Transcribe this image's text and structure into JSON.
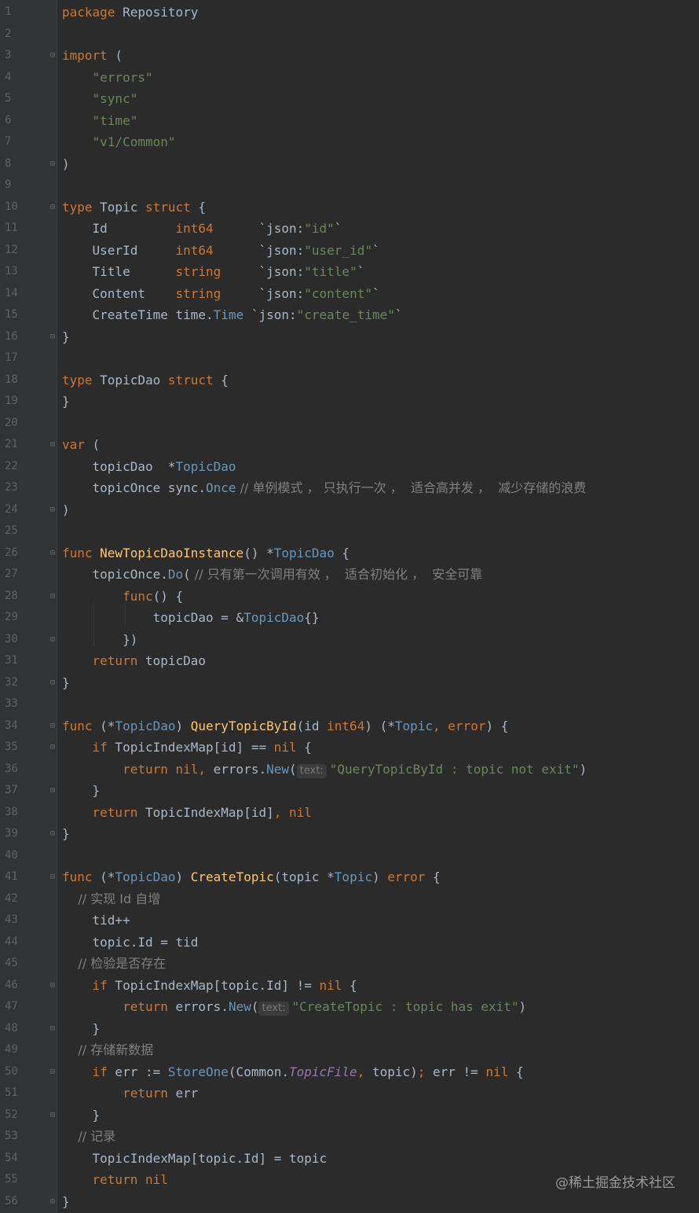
{
  "watermark": "@稀土掘金技术社区",
  "colors": {
    "background": "#2b2b2b",
    "keyword": "#cc7832",
    "string": "#6a8759",
    "function": "#ffc66d",
    "comment": "#808080",
    "type": "#6897bb"
  },
  "lines": [
    {
      "n": "1",
      "tokens": [
        [
          "kw",
          "package"
        ],
        [
          "id",
          " Repository"
        ]
      ]
    },
    {
      "n": "2",
      "tokens": []
    },
    {
      "n": "3",
      "fold": true,
      "tokens": [
        [
          "kw",
          "import"
        ],
        [
          "id",
          " ("
        ]
      ]
    },
    {
      "n": "4",
      "tokens": [
        [
          "str",
          "    \"errors\""
        ]
      ]
    },
    {
      "n": "5",
      "tokens": [
        [
          "str",
          "    \"sync\""
        ]
      ]
    },
    {
      "n": "6",
      "tokens": [
        [
          "str",
          "    \"time\""
        ]
      ]
    },
    {
      "n": "7",
      "tokens": [
        [
          "str",
          "    \"v1/Common\""
        ]
      ]
    },
    {
      "n": "8",
      "fold": true,
      "tokens": [
        [
          "id",
          ")"
        ]
      ]
    },
    {
      "n": "9",
      "tokens": []
    },
    {
      "n": "10",
      "fold": true,
      "tokens": [
        [
          "kw",
          "type"
        ],
        [
          "id",
          " Topic "
        ],
        [
          "kw",
          "struct"
        ],
        [
          "id",
          " {"
        ]
      ]
    },
    {
      "n": "11",
      "tokens": [
        [
          "id",
          "    Id         "
        ],
        [
          "kw",
          "int64"
        ],
        [
          "id",
          "      `json:"
        ],
        [
          "str",
          "\"id\""
        ],
        [
          "id",
          "`"
        ]
      ]
    },
    {
      "n": "12",
      "tokens": [
        [
          "id",
          "    UserId     "
        ],
        [
          "kw",
          "int64"
        ],
        [
          "id",
          "      `json:"
        ],
        [
          "str",
          "\"user_id\""
        ],
        [
          "id",
          "`"
        ]
      ]
    },
    {
      "n": "13",
      "tokens": [
        [
          "id",
          "    Title      "
        ],
        [
          "kw",
          "string"
        ],
        [
          "id",
          "     `json:"
        ],
        [
          "str",
          "\"title\""
        ],
        [
          "id",
          "`"
        ]
      ]
    },
    {
      "n": "14",
      "tokens": [
        [
          "id",
          "    Content    "
        ],
        [
          "kw",
          "string"
        ],
        [
          "id",
          "     `json:"
        ],
        [
          "str",
          "\"content\""
        ],
        [
          "id",
          "`"
        ]
      ]
    },
    {
      "n": "15",
      "tokens": [
        [
          "id",
          "    CreateTime "
        ],
        [
          "id",
          "time."
        ],
        [
          "type",
          "Time"
        ],
        [
          "id",
          " `json:"
        ],
        [
          "str",
          "\"create_time\""
        ],
        [
          "id",
          "`"
        ]
      ]
    },
    {
      "n": "16",
      "fold": true,
      "tokens": [
        [
          "id",
          "}"
        ]
      ]
    },
    {
      "n": "17",
      "tokens": []
    },
    {
      "n": "18",
      "tokens": [
        [
          "kw",
          "type"
        ],
        [
          "id",
          " TopicDao "
        ],
        [
          "kw",
          "struct"
        ],
        [
          "id",
          " {"
        ]
      ]
    },
    {
      "n": "19",
      "tokens": [
        [
          "id",
          "}"
        ]
      ]
    },
    {
      "n": "20",
      "tokens": []
    },
    {
      "n": "21",
      "fold": true,
      "tokens": [
        [
          "kw",
          "var"
        ],
        [
          "id",
          " ("
        ]
      ]
    },
    {
      "n": "22",
      "tokens": [
        [
          "id",
          "    topicDao  *"
        ],
        [
          "type",
          "TopicDao"
        ]
      ]
    },
    {
      "n": "23",
      "tokens": [
        [
          "id",
          "    topicOnce "
        ],
        [
          "id",
          "sync."
        ],
        [
          "type",
          "Once"
        ],
        [
          "cmt",
          " // 单例模式 ， 只执行一次 ，  适合高并发 ，  减少存储的浪费"
        ]
      ]
    },
    {
      "n": "24",
      "fold": true,
      "tokens": [
        [
          "id",
          ")"
        ]
      ]
    },
    {
      "n": "25",
      "tokens": []
    },
    {
      "n": "26",
      "fold": true,
      "tokens": [
        [
          "kw",
          "func"
        ],
        [
          "fn",
          " NewTopicDaoInstance"
        ],
        [
          "id",
          "() *"
        ],
        [
          "type",
          "TopicDao"
        ],
        [
          "id",
          " {"
        ]
      ]
    },
    {
      "n": "27",
      "tokens": [
        [
          "id",
          "    topicOnce."
        ],
        [
          "type",
          "Do"
        ],
        [
          "id",
          "("
        ],
        [
          "cmt",
          " // 只有第一次调用有效 ，  适合初始化 ，  安全可靠"
        ]
      ]
    },
    {
      "n": "28",
      "fold": true,
      "tokens": [
        [
          "kw",
          "        func"
        ],
        [
          "id",
          "() {"
        ]
      ]
    },
    {
      "n": "29",
      "tokens": [
        [
          "id",
          "            topicDao = &"
        ],
        [
          "type",
          "TopicDao"
        ],
        [
          "id",
          "{}"
        ]
      ]
    },
    {
      "n": "30",
      "fold": true,
      "tokens": [
        [
          "id",
          "        })"
        ]
      ]
    },
    {
      "n": "31",
      "tokens": [
        [
          "kw",
          "    return"
        ],
        [
          "id",
          " topicDao"
        ]
      ]
    },
    {
      "n": "32",
      "fold": true,
      "tokens": [
        [
          "id",
          "}"
        ]
      ]
    },
    {
      "n": "33",
      "tokens": []
    },
    {
      "n": "34",
      "fold": true,
      "tokens": [
        [
          "kw",
          "func"
        ],
        [
          "id",
          " (*"
        ],
        [
          "type",
          "TopicDao"
        ],
        [
          "id",
          ") "
        ],
        [
          "fn",
          "QueryTopicById"
        ],
        [
          "id",
          "(id "
        ],
        [
          "kw",
          "int64"
        ],
        [
          "id",
          ") (*"
        ],
        [
          "type",
          "Topic"
        ],
        [
          "kw",
          ", error"
        ],
        [
          "id",
          ") {"
        ]
      ]
    },
    {
      "n": "35",
      "fold": true,
      "tokens": [
        [
          "kw",
          "    if"
        ],
        [
          "id",
          " TopicIndexMap[id] == "
        ],
        [
          "kw",
          "nil"
        ],
        [
          "id",
          " {"
        ]
      ]
    },
    {
      "n": "36",
      "tokens": [
        [
          "kw",
          "        return nil, "
        ],
        [
          "id",
          "errors."
        ],
        [
          "type",
          "New"
        ],
        [
          "id",
          "("
        ],
        [
          "hint",
          "text:"
        ],
        [
          "str",
          "\"QueryTopicById : topic not exit\""
        ],
        [
          "id",
          ")"
        ]
      ]
    },
    {
      "n": "37",
      "fold": true,
      "tokens": [
        [
          "id",
          "    }"
        ]
      ]
    },
    {
      "n": "38",
      "tokens": [
        [
          "kw",
          "    return"
        ],
        [
          "id",
          " TopicIndexMap[id]"
        ],
        [
          "kw",
          ", nil"
        ]
      ]
    },
    {
      "n": "39",
      "fold": true,
      "tokens": [
        [
          "id",
          "}"
        ]
      ]
    },
    {
      "n": "40",
      "tokens": []
    },
    {
      "n": "41",
      "fold": true,
      "tokens": [
        [
          "kw",
          "func"
        ],
        [
          "id",
          " (*"
        ],
        [
          "type",
          "TopicDao"
        ],
        [
          "id",
          ") "
        ],
        [
          "fn",
          "CreateTopic"
        ],
        [
          "id",
          "(topic *"
        ],
        [
          "type",
          "Topic"
        ],
        [
          "id",
          ") "
        ],
        [
          "kw",
          "error"
        ],
        [
          "id",
          " {"
        ]
      ]
    },
    {
      "n": "42",
      "tokens": [
        [
          "cmt",
          "    // 实现 Id 自增"
        ]
      ]
    },
    {
      "n": "43",
      "tokens": [
        [
          "id",
          "    tid++"
        ]
      ]
    },
    {
      "n": "44",
      "tokens": [
        [
          "id",
          "    topic.Id = tid"
        ]
      ]
    },
    {
      "n": "45",
      "tokens": [
        [
          "cmt",
          "    // 检验是否存在"
        ]
      ]
    },
    {
      "n": "46",
      "fold": true,
      "tokens": [
        [
          "kw",
          "    if"
        ],
        [
          "id",
          " TopicIndexMap[topic.Id] != "
        ],
        [
          "kw",
          "nil"
        ],
        [
          "id",
          " {"
        ]
      ]
    },
    {
      "n": "47",
      "tokens": [
        [
          "kw",
          "        return "
        ],
        [
          "id",
          "errors."
        ],
        [
          "type",
          "New"
        ],
        [
          "id",
          "("
        ],
        [
          "hint",
          "text:"
        ],
        [
          "str",
          "\"CreateTopic : topic has exit\""
        ],
        [
          "id",
          ")"
        ]
      ]
    },
    {
      "n": "48",
      "fold": true,
      "tokens": [
        [
          "id",
          "    }"
        ]
      ]
    },
    {
      "n": "49",
      "tokens": [
        [
          "cmt",
          "    // 存储新数据"
        ]
      ]
    },
    {
      "n": "50",
      "fold": true,
      "tokens": [
        [
          "kw",
          "    if"
        ],
        [
          "id",
          " err := "
        ],
        [
          "type",
          "StoreOne"
        ],
        [
          "id",
          "(Common."
        ],
        [
          "fld",
          "TopicFile"
        ],
        [
          "kw",
          ", "
        ],
        [
          "id",
          "topic)"
        ],
        [
          "kw",
          "; "
        ],
        [
          "id",
          "err != "
        ],
        [
          "kw",
          "nil"
        ],
        [
          "id",
          " {"
        ]
      ]
    },
    {
      "n": "51",
      "tokens": [
        [
          "kw",
          "        return"
        ],
        [
          "id",
          " err"
        ]
      ]
    },
    {
      "n": "52",
      "fold": true,
      "tokens": [
        [
          "id",
          "    }"
        ]
      ]
    },
    {
      "n": "53",
      "tokens": [
        [
          "cmt",
          "    // 记录"
        ]
      ]
    },
    {
      "n": "54",
      "tokens": [
        [
          "id",
          "    TopicIndexMap[topic.Id] = topic"
        ]
      ]
    },
    {
      "n": "55",
      "tokens": [
        [
          "kw",
          "    return nil"
        ]
      ]
    },
    {
      "n": "56",
      "fold": true,
      "tokens": [
        [
          "id",
          "}"
        ]
      ]
    }
  ]
}
